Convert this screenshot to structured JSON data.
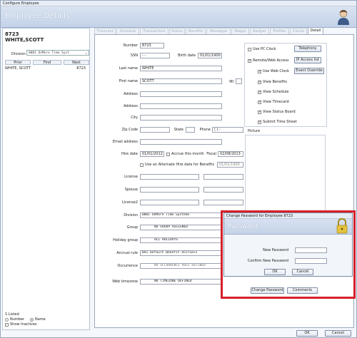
{
  "window": {
    "title": "Configure Employee",
    "banner_title": "Employee Details"
  },
  "left_panel": {
    "emp_id": "8723",
    "emp_name": "WHITE,SCOTT",
    "division_label": "Division",
    "division_value": "0001  OnMore Time Syst",
    "nav": [
      "Prior",
      "Find",
      "Next"
    ],
    "list": [
      {
        "name": "WHITE, SCOTT",
        "id": "8723"
      }
    ],
    "count_text": "1 Listed",
    "sort_number": "Number",
    "sort_name": "Name",
    "show_inactives": "Show Inactives"
  },
  "tabs": [
    "Timecard",
    "Schedule",
    "Transactions",
    "Status",
    "Benefits",
    "Messages",
    "Wages",
    "Badges",
    "Profiles",
    "Clocks",
    "Detail"
  ],
  "form": {
    "number_label": "Number",
    "number": "8723",
    "ssn_label": "SSN",
    "ssn": "-   -",
    "birth_label": "Birth date",
    "birth": "01/01/1900",
    "last_label": "Last name",
    "last": "WHITE",
    "first_label": "First name",
    "first": "SCOTT",
    "mi_label": "MI",
    "mi": "",
    "address_label": "Address",
    "city_label": "City",
    "zip_label": "Zip Code",
    "state_label": "State",
    "phone_label": "Phone",
    "phone": "(  )   -",
    "email_label": "Email address",
    "hire_label": "Hire date",
    "hire": "01/01/2012",
    "accrue_label": "Accrue this month",
    "fiscal_label": "Fiscal",
    "fiscal": "02/08/2013",
    "alt_hire_label": "Use an Alternate Hire date for Benefits",
    "alt_hire": "01/01/1900",
    "license_label": "License",
    "spouse_label": "Spouse",
    "license2_label": "License2",
    "division_label": "Division",
    "division": "0001  OnMore Time Systems",
    "group_label": "Group",
    "group": "NO GROUP ASSIGNED",
    "holiday_label": "Holiday group",
    "holiday": "ALL HOLIDAYS",
    "accrual_label": "Accrual rule",
    "accrual": "BA1   Default Benefit Accruals",
    "occurrence_label": "Occurrence",
    "occurrence": "NO OCCURRENCE RULE DEFINED",
    "timezone_label": "Web timezone",
    "timezone": "NO TIMEZONE DEFINED"
  },
  "options": {
    "use_pc_clock": "Use PC Clock",
    "telephony": "Telephony",
    "remote_web": "Remote/Web Access",
    "ip_access": "IP Access list",
    "use_web_clock": "Use Web Clock",
    "event_override": "Event Override",
    "view_benefits": "View Benefits",
    "view_schedule": "View Schedule",
    "view_timecard": "View Timecard",
    "view_status": "View Status Board",
    "submit_timesheet": "Submit Time Sheet",
    "picture_label": "Picture"
  },
  "bottom_buttons": {
    "change_password": "Change Password",
    "comments": "Comments"
  },
  "dialog": {
    "title": "Change Password for Employee 8723",
    "banner": "Password",
    "new_label": "New Password",
    "confirm_label": "Confirm New Password",
    "ok": "OK",
    "cancel": "Cancel"
  },
  "footer": {
    "ok": "OK",
    "cancel": "Cancel"
  },
  "colors": {
    "highlight": "#d4202b",
    "banner": "#c4d2e8"
  }
}
